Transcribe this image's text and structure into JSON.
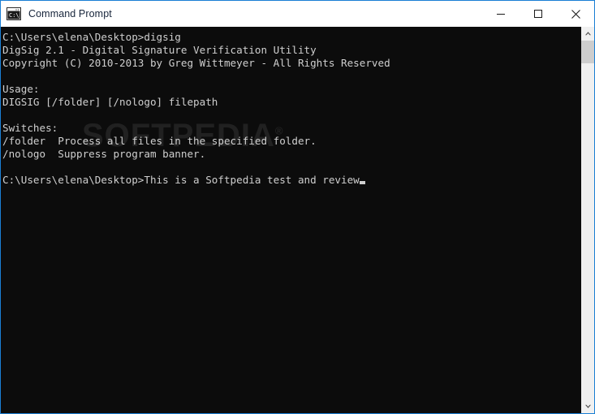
{
  "window": {
    "title": "Command Prompt",
    "icon": "console-icon",
    "border_color": "#1a7fd4",
    "titlebar_bg": "#ffffff",
    "title_color": "#16243a",
    "controls": {
      "minimize_label": "Minimize",
      "maximize_label": "Maximize",
      "close_label": "Close"
    }
  },
  "console": {
    "background": "#0c0c0c",
    "foreground": "#cfcfcf",
    "lines": [
      "C:\\Users\\elena\\Desktop>digsig",
      "DigSig 2.1 - Digital Signature Verification Utility",
      "Copyright (C) 2010-2013 by Greg Wittmeyer - All Rights Reserved",
      "",
      "Usage:",
      "DIGSIG [/folder] [/nologo] filepath",
      "",
      "Switches:",
      "/folder  Process all files in the specified folder.",
      "/nologo  Suppress program banner.",
      ""
    ],
    "prompt": "C:\\Users\\elena\\Desktop>",
    "typed_command": "This is a Softpedia test and review",
    "cursor": "_"
  },
  "watermark": {
    "text": "SOFTPEDIA",
    "mark": "®"
  },
  "scrollbar": {
    "up_arrow": "scroll-up-icon",
    "down_arrow": "scroll-down-icon",
    "thumb": "scroll-thumb"
  }
}
